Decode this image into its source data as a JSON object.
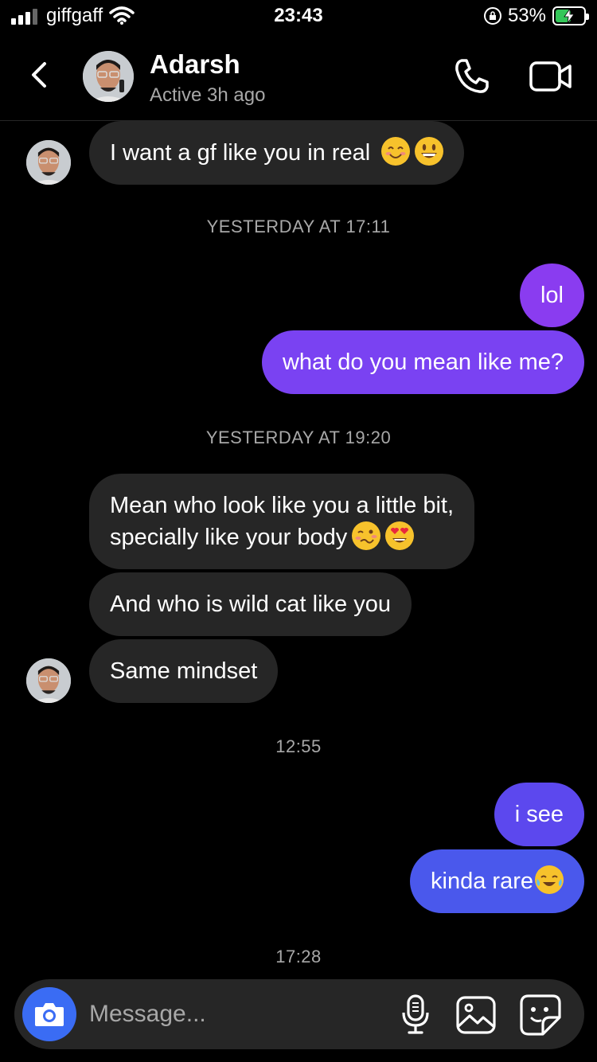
{
  "status_bar": {
    "carrier": "giffgaff",
    "time": "23:43",
    "battery": "53%",
    "battery_level": 0.53
  },
  "header": {
    "contact_name": "Adarsh",
    "activity": "Active 3h ago"
  },
  "messages": [
    {
      "type": "received",
      "text": "I want a gf like you in real"
    },
    {
      "type": "timestamp",
      "text": "YESTERDAY AT 17:11"
    },
    {
      "type": "sent",
      "text": "lol"
    },
    {
      "type": "sent",
      "text": "what do you mean like me?"
    },
    {
      "type": "timestamp",
      "text": "YESTERDAY AT 19:20"
    },
    {
      "type": "received",
      "line1": "Mean who look like you a little bit,",
      "line2": "specially like your body"
    },
    {
      "type": "received",
      "text": "And who is wild cat like you"
    },
    {
      "type": "received",
      "text": "Same mindset"
    },
    {
      "type": "timestamp",
      "text": "12:55"
    },
    {
      "type": "sent",
      "text": "i see"
    },
    {
      "type": "sent",
      "text": "kinda rare"
    },
    {
      "type": "timestamp",
      "text": "17:28"
    }
  ],
  "composer": {
    "placeholder": "Message..."
  },
  "colors": {
    "background": "#000000",
    "received_bubble": "#262626",
    "sent_purple": "#7a3af0",
    "sent_blue": "#4a58ec",
    "camera_button": "#3a6cf4",
    "muted_text": "#a8a8a8"
  },
  "icons": [
    "signal-icon",
    "wifi-icon",
    "orientation-lock-icon",
    "battery-icon",
    "back-chevron-icon",
    "phone-icon",
    "video-icon",
    "camera-icon",
    "microphone-icon",
    "gallery-icon",
    "sticker-icon"
  ]
}
